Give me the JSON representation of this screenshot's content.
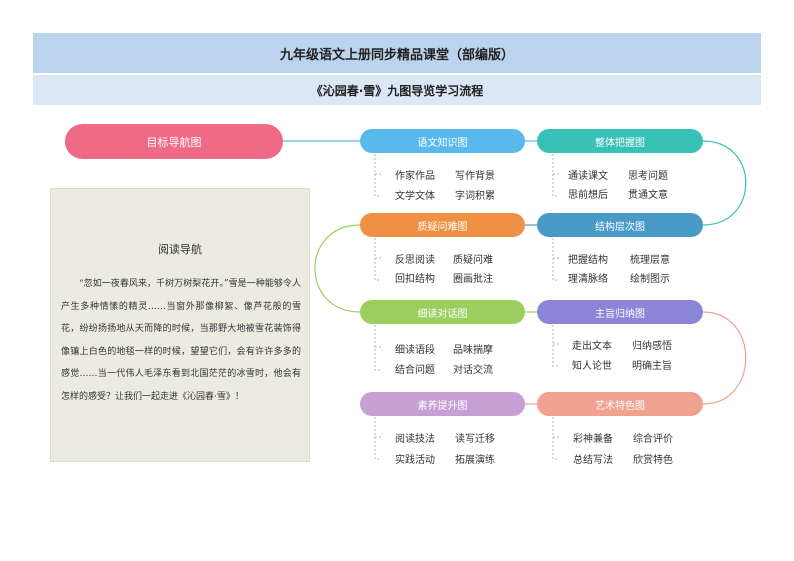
{
  "header": {
    "title": "九年级语文上册同步精品课堂（部编版）",
    "subtitle": "《沁园春·雪》九图导览学习流程"
  },
  "goal": {
    "label": "目标导航图"
  },
  "nodes": [
    {
      "id": "yuwen",
      "label": "语文知识图",
      "color": "#5ab9ec",
      "items": [
        "作家作品",
        "写作背景",
        "文学文体",
        "字词积累"
      ]
    },
    {
      "id": "zhengti",
      "label": "整体把握图",
      "color": "#37c1b7",
      "items": [
        "通读课文",
        "思考问题",
        "思前想后",
        "贯通文意"
      ]
    },
    {
      "id": "jiegou",
      "label": "结构层次图",
      "color": "#4a9ac8",
      "items": [
        "把握结构",
        "梳理层意",
        "理清脉络",
        "绘制图示"
      ]
    },
    {
      "id": "zhiyi",
      "label": "质疑问难图",
      "color": "#f09045",
      "items": [
        "反思阅读",
        "质疑问难",
        "回扣结构",
        "圈画批注"
      ]
    },
    {
      "id": "xidu",
      "label": "细读对话图",
      "color": "#9bce5d",
      "items": [
        "细读语段",
        "品味揣摩",
        "结合问题",
        "对话交流"
      ]
    },
    {
      "id": "zhuzhi",
      "label": "主旨归纳图",
      "color": "#8c86d8",
      "items": [
        "走出文本",
        "归纳感悟",
        "知人论世",
        "明确主旨"
      ]
    },
    {
      "id": "suyang",
      "label": "素养提升图",
      "color": "#c69fd4",
      "items": [
        "阅读技法",
        "读写迁移",
        "实践活动",
        "拓展演练"
      ]
    },
    {
      "id": "yishu",
      "label": "艺术特色图",
      "color": "#efa290",
      "items": [
        "彩神兼备",
        "综合评价",
        "总结写法",
        "欣赏特色"
      ]
    }
  ],
  "reading": {
    "title": "阅读导航",
    "text": "“忽如一夜春风来，千树万树梨花开。”雪是一种能够令人产生多种情愫的精灵……当窗外那像柳絮、像芦花般的雪花，纷纷扬扬地从天而降的时候，当那野大地被雪花装饰得像镶上白色的地毯一样的时候，望望它们，会有许许多多的感觉……当一代伟人毛泽东看到北国茫茫的冰雪时，他会有怎样的感受？让我们一起走进《沁园春·雪》！"
  },
  "colors": {
    "header_bg": "#bcd3ee",
    "subheader_bg": "#dbe7f5",
    "goal": "#ef6a86"
  }
}
